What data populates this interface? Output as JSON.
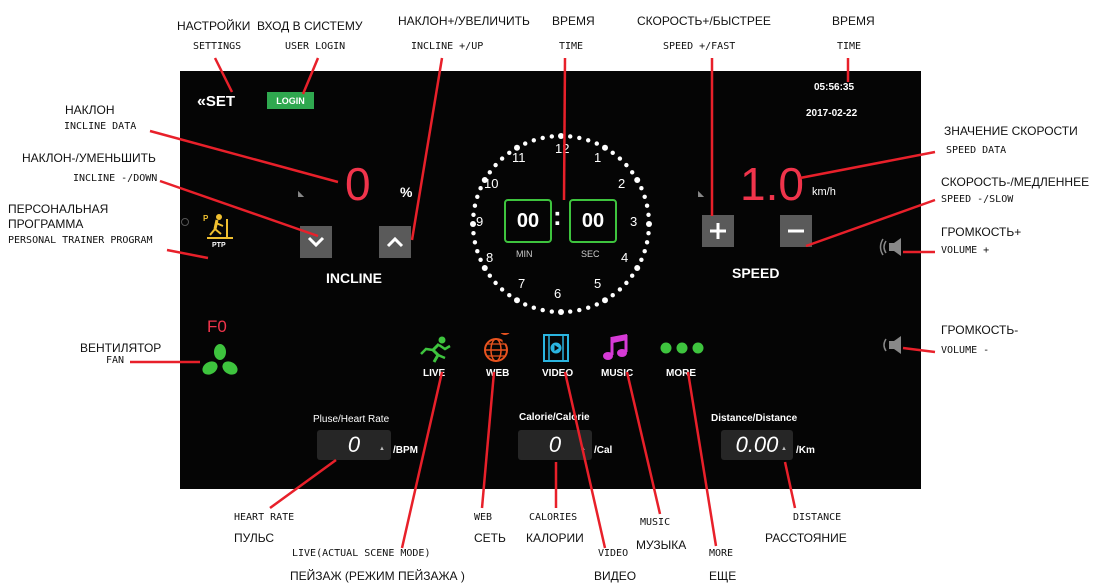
{
  "annotations": {
    "settings_ru": "НАСТРОЙКИ",
    "settings_en": "SETTINGS",
    "login_ru": "ВХОД В СИСТЕМУ",
    "login_en": "USER LOGIN",
    "incline_up_ru": "НАКЛОН+/УВЕЛИЧИТЬ",
    "incline_up_en": "INCLINE +/UP",
    "time1_ru": "ВРЕМЯ",
    "time1_en": "TIME",
    "speed_fast_ru": "СКОРОСТЬ+/БЫСТРЕЕ",
    "speed_fast_en": "SPEED +/FAST",
    "time2_ru": "ВРЕМЯ",
    "time2_en": "TIME",
    "incline_data_ru": "НАКЛОН",
    "incline_data_en": "INCLINE DATA",
    "incline_down_ru": "НАКЛОН-/УМЕНЬШИТЬ",
    "incline_down_en": "INCLINE -/DOWN",
    "ptp_ru_1": "ПЕРСОНАЛЬНАЯ",
    "ptp_ru_2": "ПРОГРАММА",
    "ptp_en": "PERSONAL TRAINER PROGRAM",
    "speed_data_ru": "ЗНАЧЕНИЕ СКОРОСТИ",
    "speed_data_en": "SPEED DATA",
    "speed_slow_ru": "СКОРОСТЬ-/МЕДЛЕННЕЕ",
    "speed_slow_en": "SPEED -/SLOW",
    "vol_up_ru": "ГРОМКОСТЬ+",
    "vol_up_en": "VOLUME +",
    "vol_down_ru": "ГРОМКОСТЬ-",
    "vol_down_en": "VOLUME -",
    "fan_ru": "ВЕНТИЛЯТОР",
    "fan_en": "FAN",
    "heart_en": "HEART RATE",
    "heart_ru": "ПУЛЬС",
    "live_en": "LIVE(ACTUAL SCENE MODE)",
    "live_ru": "ПЕЙЗАЖ (РЕЖИМ ПЕЙЗАЖА )",
    "web_en": "WEB",
    "web_ru": "СЕТЬ",
    "cal_en": "CALORIES",
    "cal_ru": "КАЛОРИИ",
    "video_en": "VIDEO",
    "video_ru": "ВИДЕО",
    "music_en": "MUSIC",
    "music_ru": "МУЗЫКА",
    "more_en": "MORE",
    "more_ru": "ЕЩЕ",
    "distance_en": "DISTANCE",
    "distance_ru": "РАССТОЯНИЕ"
  },
  "screen": {
    "set_label": "SET",
    "login_label": "LOGIN",
    "clock_time": "05:56:35",
    "clock_date": "2017-02-22",
    "incline_value": "0",
    "incline_unit": "%",
    "incline_label": "INCLINE",
    "ptp_label": "PTP",
    "timer_min": "00",
    "timer_sec": "00",
    "timer_colon": ":",
    "min_label": "MIN",
    "sec_label": "SEC",
    "dial_numbers": [
      "12",
      "1",
      "2",
      "3",
      "4",
      "5",
      "6",
      "7",
      "8",
      "9",
      "10",
      "11"
    ],
    "speed_value": "1.0",
    "speed_unit": "km/h",
    "speed_label": "SPEED",
    "fan_value": "F0",
    "apps": [
      {
        "label": "LIVE",
        "color": "#3ec43e"
      },
      {
        "label": "WEB",
        "color": "#e8531f"
      },
      {
        "label": "VIDEO",
        "color": "#2bb5e0"
      },
      {
        "label": "MUSIC",
        "color": "#d63ad6"
      },
      {
        "label": "MORE",
        "color": "#3ec43e"
      }
    ],
    "pulse_title": "Pluse/Heart Rate",
    "pulse_value": "0",
    "pulse_unit": "/BPM",
    "cal_title": "Calorie/Calorie",
    "cal_value": "0",
    "cal_unit": "/Cal",
    "dist_title": "Distance/Distance",
    "dist_value": "0.00",
    "dist_unit": "/Km"
  },
  "colors": {
    "accent_red": "#f0344b",
    "login_green": "#2fa84f",
    "timer_green": "#3ec43e",
    "ptp_yellow": "#f0c030",
    "fan_green": "#3ec43e"
  }
}
